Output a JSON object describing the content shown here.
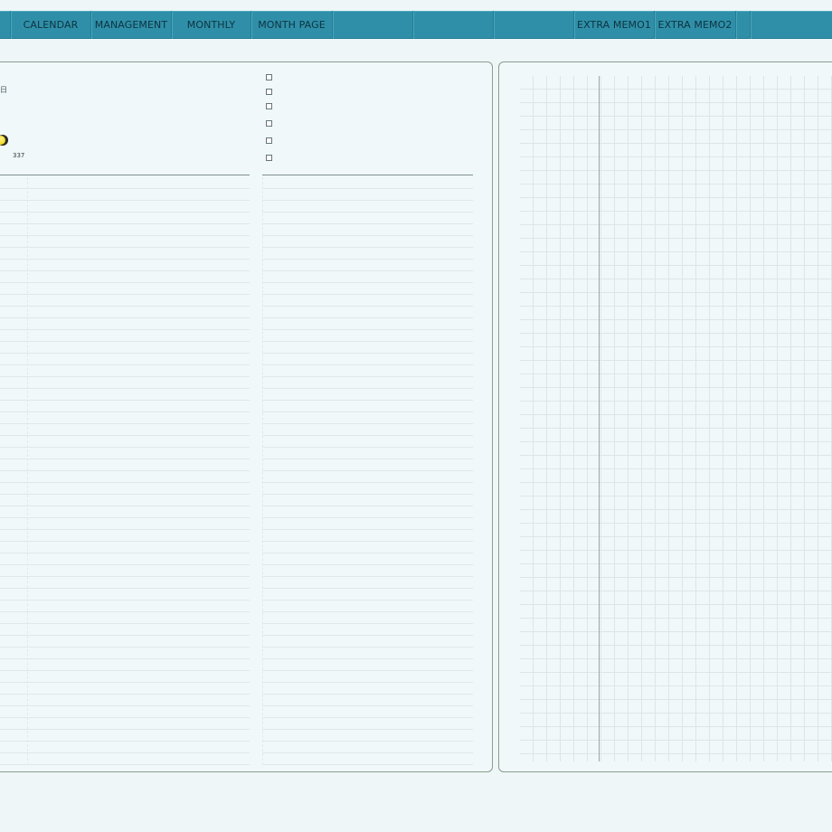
{
  "nav": {
    "tabs": [
      {
        "label": ""
      },
      {
        "label": "CALENDAR"
      },
      {
        "label": "MANAGEMENT"
      },
      {
        "label": "MONTHLY"
      },
      {
        "label": "MONTH PAGE"
      },
      {
        "label": ""
      },
      {
        "label": ""
      },
      {
        "label": ""
      },
      {
        "label": "EXTRA MEMO1"
      },
      {
        "label": "EXTRA MEMO2"
      },
      {
        "label": ""
      }
    ]
  },
  "left_panel": {
    "header_text": "日",
    "day_of_year": "337",
    "moon_icon": "moon-phase-icon",
    "checkbox_count": 6
  },
  "colors": {
    "nav_bg": "#2f8fa8",
    "page_bg": "#eef6f7",
    "panel_border": "#8a9d8c",
    "moon": "#f3d714"
  }
}
